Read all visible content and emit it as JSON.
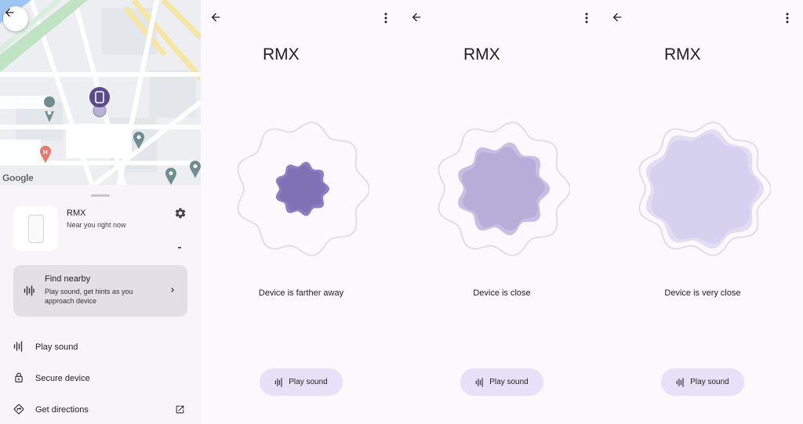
{
  "colors": {
    "accent_dark": "#7e72b5",
    "accent_mid": "#b6add9",
    "accent_light": "#d6d1ee",
    "button_bg": "#e6e0f8",
    "card_bg": "#e2dfe6"
  },
  "map": {
    "attribution": "Google",
    "back_icon": "arrow-back-icon"
  },
  "sheet": {
    "device_name": "RMX",
    "device_status": "Near you right now",
    "settings_icon": "gear-icon",
    "find_nearby": {
      "title": "Find nearby",
      "description": "Play sound, get hints as you approach device",
      "icon": "sound-wave-icon"
    },
    "actions": [
      {
        "label": "Play sound",
        "icon": "sound-wave-icon"
      },
      {
        "label": "Secure device",
        "icon": "lock-icon"
      },
      {
        "label": "Get directions",
        "icon": "directions-icon",
        "trailing_icon": "open-external-icon"
      }
    ]
  },
  "proximity_screens": [
    {
      "title": "RMX",
      "status": "Device is farther away",
      "button_label": "Play sound",
      "level": "far"
    },
    {
      "title": "RMX",
      "status": "Device is close",
      "button_label": "Play sound",
      "level": "close"
    },
    {
      "title": "RMX",
      "status": "Device is very close",
      "button_label": "Play sound",
      "level": "very-close"
    }
  ]
}
